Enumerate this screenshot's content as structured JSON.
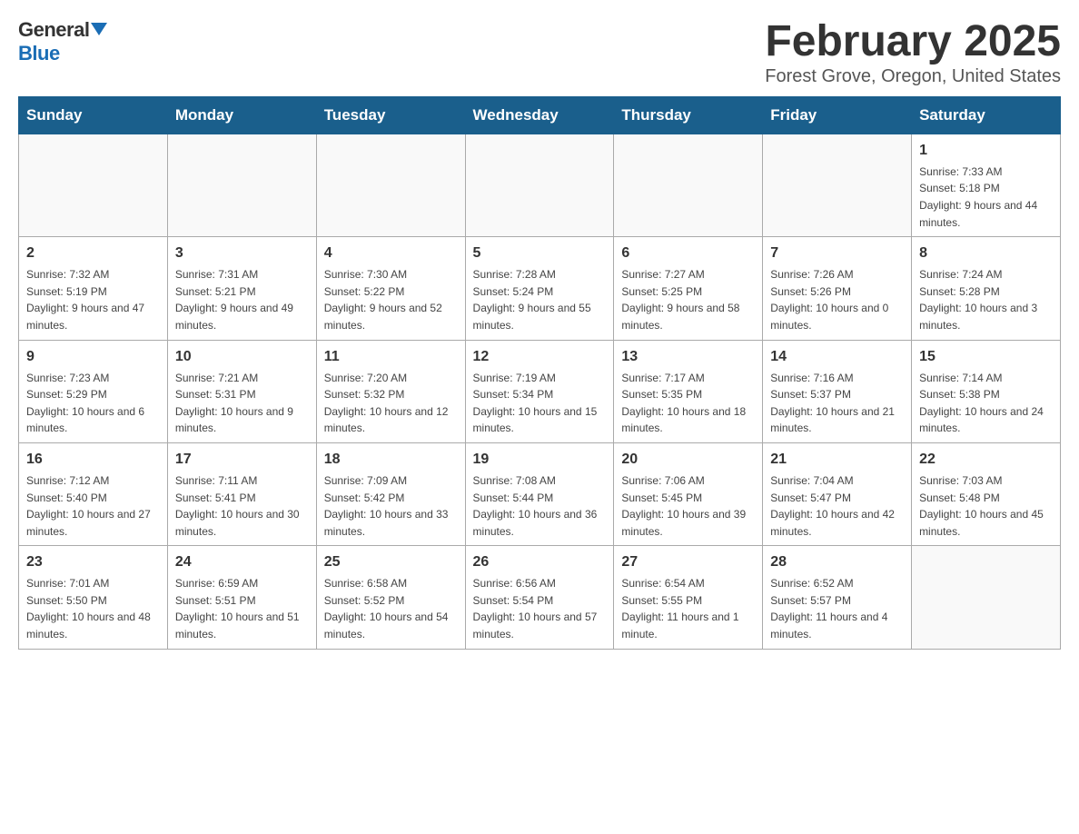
{
  "header": {
    "logo_general": "General",
    "logo_blue": "Blue",
    "title": "February 2025",
    "location": "Forest Grove, Oregon, United States"
  },
  "weekdays": [
    "Sunday",
    "Monday",
    "Tuesday",
    "Wednesday",
    "Thursday",
    "Friday",
    "Saturday"
  ],
  "weeks": [
    [
      {
        "day": "",
        "sunrise": "",
        "sunset": "",
        "daylight": ""
      },
      {
        "day": "",
        "sunrise": "",
        "sunset": "",
        "daylight": ""
      },
      {
        "day": "",
        "sunrise": "",
        "sunset": "",
        "daylight": ""
      },
      {
        "day": "",
        "sunrise": "",
        "sunset": "",
        "daylight": ""
      },
      {
        "day": "",
        "sunrise": "",
        "sunset": "",
        "daylight": ""
      },
      {
        "day": "",
        "sunrise": "",
        "sunset": "",
        "daylight": ""
      },
      {
        "day": "1",
        "sunrise": "Sunrise: 7:33 AM",
        "sunset": "Sunset: 5:18 PM",
        "daylight": "Daylight: 9 hours and 44 minutes."
      }
    ],
    [
      {
        "day": "2",
        "sunrise": "Sunrise: 7:32 AM",
        "sunset": "Sunset: 5:19 PM",
        "daylight": "Daylight: 9 hours and 47 minutes."
      },
      {
        "day": "3",
        "sunrise": "Sunrise: 7:31 AM",
        "sunset": "Sunset: 5:21 PM",
        "daylight": "Daylight: 9 hours and 49 minutes."
      },
      {
        "day": "4",
        "sunrise": "Sunrise: 7:30 AM",
        "sunset": "Sunset: 5:22 PM",
        "daylight": "Daylight: 9 hours and 52 minutes."
      },
      {
        "day": "5",
        "sunrise": "Sunrise: 7:28 AM",
        "sunset": "Sunset: 5:24 PM",
        "daylight": "Daylight: 9 hours and 55 minutes."
      },
      {
        "day": "6",
        "sunrise": "Sunrise: 7:27 AM",
        "sunset": "Sunset: 5:25 PM",
        "daylight": "Daylight: 9 hours and 58 minutes."
      },
      {
        "day": "7",
        "sunrise": "Sunrise: 7:26 AM",
        "sunset": "Sunset: 5:26 PM",
        "daylight": "Daylight: 10 hours and 0 minutes."
      },
      {
        "day": "8",
        "sunrise": "Sunrise: 7:24 AM",
        "sunset": "Sunset: 5:28 PM",
        "daylight": "Daylight: 10 hours and 3 minutes."
      }
    ],
    [
      {
        "day": "9",
        "sunrise": "Sunrise: 7:23 AM",
        "sunset": "Sunset: 5:29 PM",
        "daylight": "Daylight: 10 hours and 6 minutes."
      },
      {
        "day": "10",
        "sunrise": "Sunrise: 7:21 AM",
        "sunset": "Sunset: 5:31 PM",
        "daylight": "Daylight: 10 hours and 9 minutes."
      },
      {
        "day": "11",
        "sunrise": "Sunrise: 7:20 AM",
        "sunset": "Sunset: 5:32 PM",
        "daylight": "Daylight: 10 hours and 12 minutes."
      },
      {
        "day": "12",
        "sunrise": "Sunrise: 7:19 AM",
        "sunset": "Sunset: 5:34 PM",
        "daylight": "Daylight: 10 hours and 15 minutes."
      },
      {
        "day": "13",
        "sunrise": "Sunrise: 7:17 AM",
        "sunset": "Sunset: 5:35 PM",
        "daylight": "Daylight: 10 hours and 18 minutes."
      },
      {
        "day": "14",
        "sunrise": "Sunrise: 7:16 AM",
        "sunset": "Sunset: 5:37 PM",
        "daylight": "Daylight: 10 hours and 21 minutes."
      },
      {
        "day": "15",
        "sunrise": "Sunrise: 7:14 AM",
        "sunset": "Sunset: 5:38 PM",
        "daylight": "Daylight: 10 hours and 24 minutes."
      }
    ],
    [
      {
        "day": "16",
        "sunrise": "Sunrise: 7:12 AM",
        "sunset": "Sunset: 5:40 PM",
        "daylight": "Daylight: 10 hours and 27 minutes."
      },
      {
        "day": "17",
        "sunrise": "Sunrise: 7:11 AM",
        "sunset": "Sunset: 5:41 PM",
        "daylight": "Daylight: 10 hours and 30 minutes."
      },
      {
        "day": "18",
        "sunrise": "Sunrise: 7:09 AM",
        "sunset": "Sunset: 5:42 PM",
        "daylight": "Daylight: 10 hours and 33 minutes."
      },
      {
        "day": "19",
        "sunrise": "Sunrise: 7:08 AM",
        "sunset": "Sunset: 5:44 PM",
        "daylight": "Daylight: 10 hours and 36 minutes."
      },
      {
        "day": "20",
        "sunrise": "Sunrise: 7:06 AM",
        "sunset": "Sunset: 5:45 PM",
        "daylight": "Daylight: 10 hours and 39 minutes."
      },
      {
        "day": "21",
        "sunrise": "Sunrise: 7:04 AM",
        "sunset": "Sunset: 5:47 PM",
        "daylight": "Daylight: 10 hours and 42 minutes."
      },
      {
        "day": "22",
        "sunrise": "Sunrise: 7:03 AM",
        "sunset": "Sunset: 5:48 PM",
        "daylight": "Daylight: 10 hours and 45 minutes."
      }
    ],
    [
      {
        "day": "23",
        "sunrise": "Sunrise: 7:01 AM",
        "sunset": "Sunset: 5:50 PM",
        "daylight": "Daylight: 10 hours and 48 minutes."
      },
      {
        "day": "24",
        "sunrise": "Sunrise: 6:59 AM",
        "sunset": "Sunset: 5:51 PM",
        "daylight": "Daylight: 10 hours and 51 minutes."
      },
      {
        "day": "25",
        "sunrise": "Sunrise: 6:58 AM",
        "sunset": "Sunset: 5:52 PM",
        "daylight": "Daylight: 10 hours and 54 minutes."
      },
      {
        "day": "26",
        "sunrise": "Sunrise: 6:56 AM",
        "sunset": "Sunset: 5:54 PM",
        "daylight": "Daylight: 10 hours and 57 minutes."
      },
      {
        "day": "27",
        "sunrise": "Sunrise: 6:54 AM",
        "sunset": "Sunset: 5:55 PM",
        "daylight": "Daylight: 11 hours and 1 minute."
      },
      {
        "day": "28",
        "sunrise": "Sunrise: 6:52 AM",
        "sunset": "Sunset: 5:57 PM",
        "daylight": "Daylight: 11 hours and 4 minutes."
      },
      {
        "day": "",
        "sunrise": "",
        "sunset": "",
        "daylight": ""
      }
    ]
  ]
}
